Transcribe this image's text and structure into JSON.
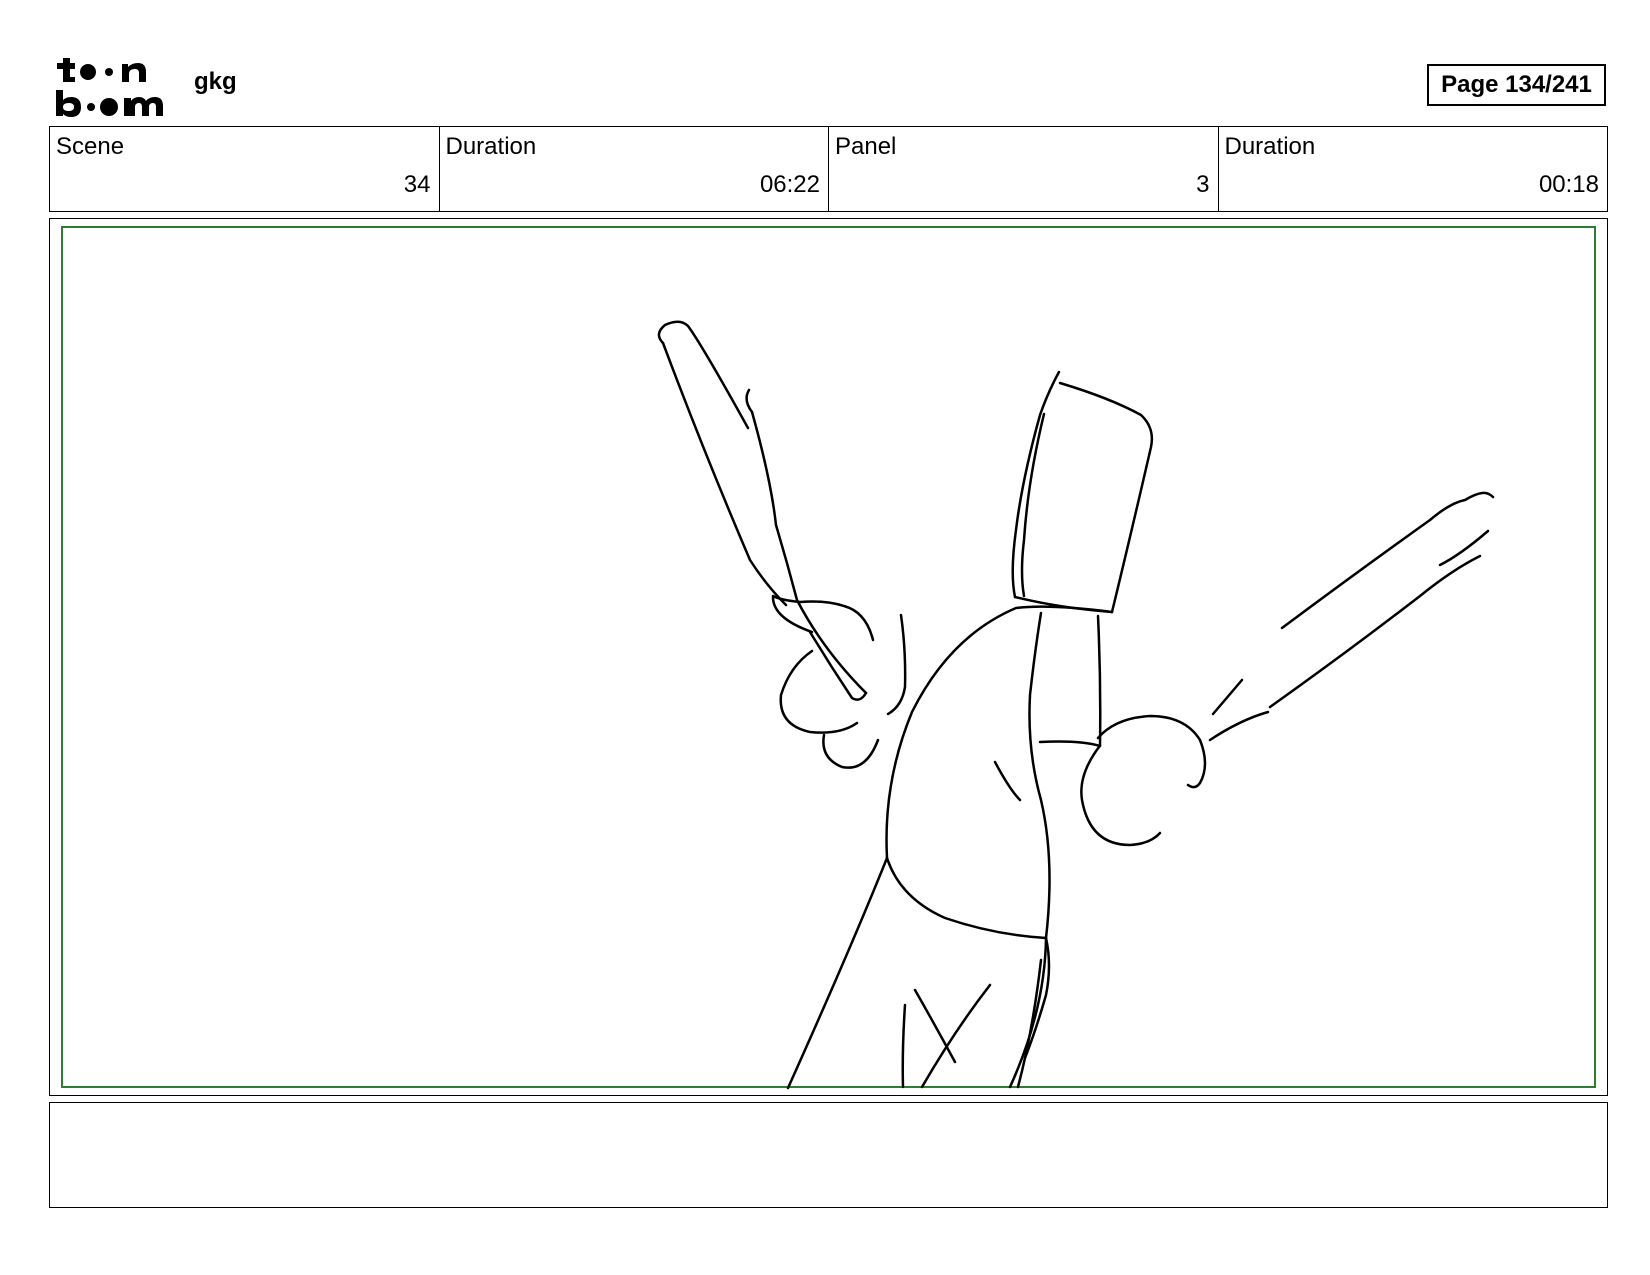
{
  "header": {
    "logo_text": "toon boom",
    "project_name": "gkg",
    "page_label": "Page 134/241"
  },
  "info": [
    {
      "label": "Scene",
      "value": "34"
    },
    {
      "label": "Duration",
      "value": "06:22"
    },
    {
      "label": "Panel",
      "value": "3"
    },
    {
      "label": "Duration",
      "value": "00:18"
    }
  ],
  "notes": {
    "text": ""
  },
  "colors": {
    "safe_frame": "#2e7d32",
    "ink": "#000000"
  },
  "icons": {
    "logo": "toon-boom-logo"
  }
}
